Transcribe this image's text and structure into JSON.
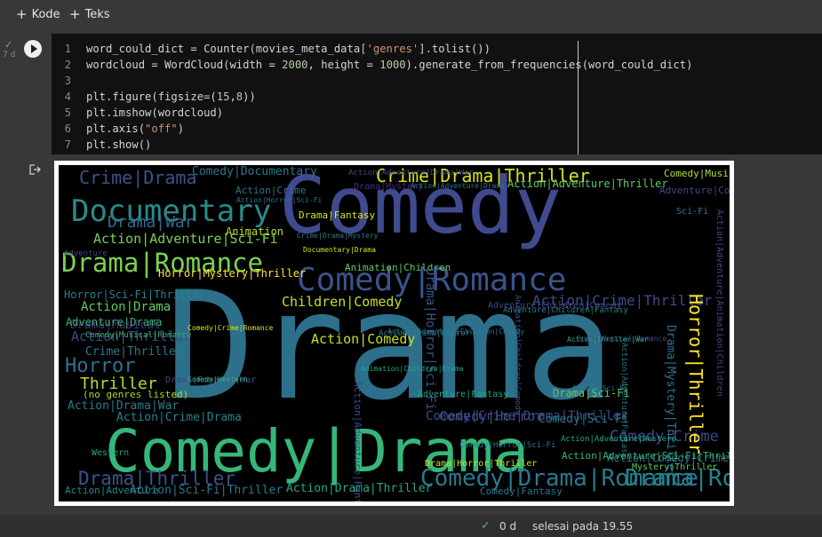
{
  "toolbar": {
    "add_code_label": "Kode",
    "add_text_label": "Teks"
  },
  "cell": {
    "status_check": "✓",
    "exec_time": "7 d",
    "lines": [
      {
        "num": "1",
        "parts": [
          [
            "t",
            "word_could_dict = Counter(movies_meta_data["
          ],
          [
            "s",
            "'genres'"
          ],
          [
            "t",
            "].tolist())"
          ]
        ]
      },
      {
        "num": "2",
        "parts": [
          [
            "t",
            "wordcloud = WordCloud(width = "
          ],
          [
            "n",
            "2000"
          ],
          [
            "t",
            ", height = "
          ],
          [
            "n",
            "1000"
          ],
          [
            "t",
            ").generate_from_frequencies(word_could_dict)"
          ]
        ]
      },
      {
        "num": "3",
        "parts": []
      },
      {
        "num": "4",
        "parts": [
          [
            "t",
            "plt.figure(figsize=("
          ],
          [
            "n",
            "15"
          ],
          [
            "t",
            ","
          ],
          [
            "n",
            "8"
          ],
          [
            "t",
            "))"
          ]
        ]
      },
      {
        "num": "5",
        "parts": [
          [
            "t",
            "plt.imshow(wordcloud)"
          ]
        ]
      },
      {
        "num": "6",
        "parts": [
          [
            "t",
            "plt.axis("
          ],
          [
            "s",
            "\"off\""
          ],
          [
            "t",
            ")"
          ]
        ]
      },
      {
        "num": "7",
        "parts": [
          [
            "t",
            "plt.show()"
          ]
        ]
      }
    ]
  },
  "wordcloud": {
    "words": [
      {
        "text": "Comedy",
        "c": "#404a8e"
      },
      {
        "text": "Drama",
        "c": "#2c708c"
      },
      {
        "text": "Comedy|Drama",
        "c": "#35b779"
      },
      {
        "text": "Documentary",
        "c": "#2a8a8a"
      },
      {
        "text": "Drama|Romance",
        "c": "#7ad151"
      },
      {
        "text": "Comedy|Romance",
        "c": "#3b528b"
      },
      {
        "text": "Crime|Drama|Thriller",
        "c": "#d8e219"
      },
      {
        "text": "Crime|Drama",
        "c": "#3b528b"
      },
      {
        "text": "Drama|War",
        "c": "#2f6b8e"
      },
      {
        "text": "Action|Adventure|Sci-Fi",
        "c": "#7ad151"
      },
      {
        "text": "Horror|Mystery|Thriller",
        "c": "#fde725"
      },
      {
        "text": "Children|Comedy",
        "c": "#c5e021"
      },
      {
        "text": "Action|Comedy",
        "c": "#c5e021"
      },
      {
        "text": "Action|Drama",
        "c": "#5ec962"
      },
      {
        "text": "Horror",
        "c": "#2c728e"
      },
      {
        "text": "Thriller",
        "c": "#b5de2b"
      },
      {
        "text": "Action|Thriller",
        "c": "#3e4a89"
      },
      {
        "text": "Drama|Musical",
        "c": "#472c7a"
      },
      {
        "text": "Adventure|Drama",
        "c": "#35b779"
      },
      {
        "text": "Crime|Thriller",
        "c": "#2a788e"
      },
      {
        "text": "(no genres listed)",
        "c": "#a0da39"
      },
      {
        "text": "Action|Drama|War",
        "c": "#2a788e"
      },
      {
        "text": "Action|Crime|Drama",
        "c": "#26828e"
      },
      {
        "text": "Drama|Thriller",
        "c": "#3b528b"
      },
      {
        "text": "Action|Sci-Fi|Thriller",
        "c": "#2a788e"
      },
      {
        "text": "Action|Adventure",
        "c": "#25858e"
      },
      {
        "text": "Action|Drama|Thriller",
        "c": "#22a884"
      },
      {
        "text": "Comedy|Drama|Romance",
        "c": "#2a788e"
      },
      {
        "text": "Drama|Romance",
        "c": "#26828e"
      },
      {
        "text": "Comedy|Crime|Drama|Thriller",
        "c": "#3e4a89"
      },
      {
        "text": "Comedy|Crime",
        "c": "#3e4a89"
      },
      {
        "text": "Action|Crime|Thriller",
        "c": "#3e4a89"
      },
      {
        "text": "Horror|Thriller",
        "c": "#fde725"
      },
      {
        "text": "Drama|Mystery|Thriller",
        "c": "#2c728e"
      },
      {
        "text": "Comedy|Horror",
        "c": "#3e4a89"
      },
      {
        "text": "Comedy|Sci-Fi",
        "c": "#2a788e"
      },
      {
        "text": "Action|Comedy|Crime",
        "c": "#2a788e"
      },
      {
        "text": "Drama|Sci-Fi",
        "c": "#5ec962"
      },
      {
        "text": "Animation|Children",
        "c": "#5ec962"
      },
      {
        "text": "Adventure|Children|Comedy",
        "c": "#3e4a89"
      },
      {
        "text": "Drama|Horror|Sci-Fi",
        "c": "#3b528b"
      },
      {
        "text": "Horror|Sci-Fi|Thriller",
        "c": "#26828e"
      },
      {
        "text": "Comedy|Documentary",
        "c": "#2a788e"
      },
      {
        "text": "Comedy|Musical",
        "c": "#b5de2b"
      },
      {
        "text": "Sci-Fi",
        "c": "#26828e"
      },
      {
        "text": "Action|Crime",
        "c": "#2a788e"
      },
      {
        "text": "Action|Adventure|Thriller",
        "c": "#5ec962"
      },
      {
        "text": "Animation",
        "c": "#b5de2b"
      },
      {
        "text": "Drama|Fantasy",
        "c": "#d8e219"
      },
      {
        "text": "Action|Adventure|Drama|War",
        "c": "#3e4a89"
      },
      {
        "text": "Western",
        "c": "#22a884"
      },
      {
        "text": "Comedy|Fantasy",
        "c": "#2a788e"
      },
      {
        "text": "Drama|Mystery",
        "c": "#472c7a"
      },
      {
        "text": "Action|Adventure|Sci-Fi|Thriller",
        "c": "#35b779"
      },
      {
        "text": "Mystery|Thriller",
        "c": "#5ec962"
      },
      {
        "text": "Drama|Horror|Thriller",
        "c": "#c5e021"
      },
      {
        "text": "Comedy|Horror|Sci-Fi",
        "c": "#2a788e"
      },
      {
        "text": "Drama|Romance|War",
        "c": "#3e4a89"
      },
      {
        "text": "Comedy|Musical|Romance",
        "c": "#35b779"
      },
      {
        "text": "Action|Adventure|Fantasy",
        "c": "#3e4a89"
      },
      {
        "text": "Animation|Children|Comedy",
        "c": "#3e4a89"
      },
      {
        "text": "Action|Horror|Sci-Fi",
        "c": "#2a788e"
      },
      {
        "text": "Crime|Drama|Mystery",
        "c": "#2a788e"
      },
      {
        "text": "Action|Adventure|Drama",
        "c": "#2a788e"
      },
      {
        "text": "Adventure|Comedy",
        "c": "#3e4a89"
      },
      {
        "text": "Drama|Musical|Romance",
        "c": "#3e4a89"
      },
      {
        "text": "Action|Adventure|Animation|Children",
        "c": "#3e4a89"
      },
      {
        "text": "Adventure|Children|Fantasy",
        "c": "#26828e"
      },
      {
        "text": "Action|Drama|Horror",
        "c": "#2a788e"
      },
      {
        "text": "Documentary|Drama",
        "c": "#d8e219"
      },
      {
        "text": "Adventure|Fantasy",
        "c": "#22a884"
      },
      {
        "text": "Adventure",
        "c": "#3e4a89"
      },
      {
        "text": "Comedy|Western",
        "c": "#35b779"
      },
      {
        "text": "Comedy|Crime|Romance",
        "c": "#d8e219"
      },
      {
        "text": "Animation|Children|Drama",
        "c": "#22a884"
      },
      {
        "text": "Action|Adventure|Fantasy",
        "c": "#2a788e"
      },
      {
        "text": "Action|Adventure|Western",
        "c": "#22a884"
      },
      {
        "text": "Action|Adventure|Children|Comedy",
        "c": "#2a788e"
      },
      {
        "text": "Action|Sci-Fi",
        "c": "#2a788e"
      },
      {
        "text": "Action|Thriller|War",
        "c": "#22a884"
      }
    ]
  },
  "footer": {
    "check": "✓",
    "time": "0 d",
    "status": "selesai pada 19.55"
  }
}
